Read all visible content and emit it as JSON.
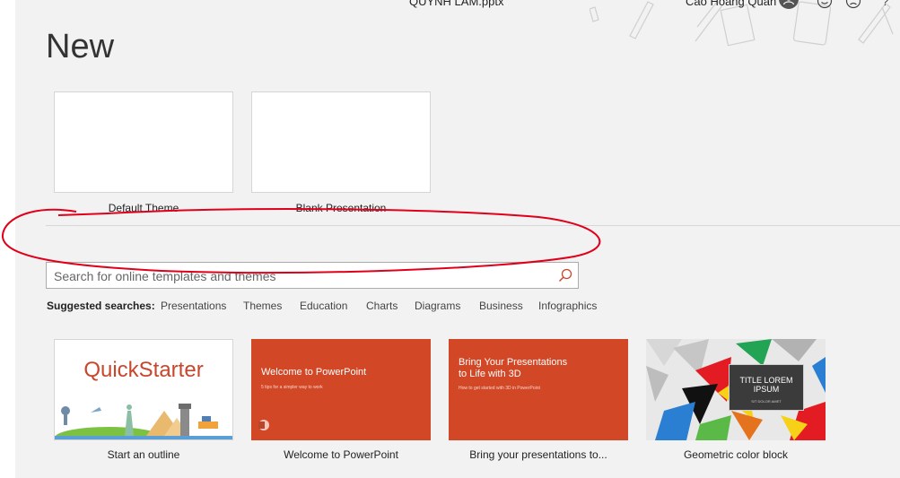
{
  "window": {
    "file_name": "QUYNH LAM.pptx",
    "user_name": "Cao Hoang Quan",
    "help_label": "?"
  },
  "page": {
    "heading": "New"
  },
  "blank_options": [
    {
      "caption": "Default Theme"
    },
    {
      "caption": "Blank Presentation"
    }
  ],
  "search": {
    "placeholder": "Search for online templates and themes",
    "value": ""
  },
  "suggested": {
    "label": "Suggested searches:",
    "items": [
      "Presentations",
      "Themes",
      "Education",
      "Charts",
      "Diagrams",
      "Business",
      "Infographics"
    ]
  },
  "templates": [
    {
      "caption": "Start an outline",
      "title": "QuickStarter"
    },
    {
      "caption": "Welcome to PowerPoint",
      "title": "Welcome to PowerPoint",
      "subtitle": "5 tips for a simpler way to work"
    },
    {
      "caption": "Bring your presentations to...",
      "title_line1": "Bring Your Presentations",
      "title_line2": "to Life with 3D",
      "subtitle": "How to get started with 3D in PowerPoint"
    },
    {
      "caption": "Geometric color block",
      "title_line1": "TITLE LOREM",
      "title_line2": "IPSUM",
      "subtitle": "SIT DOLOR AMET"
    }
  ],
  "colors": {
    "background": "#f2f2f2",
    "powerpoint_orange": "#d24726",
    "annotation_red": "#e0001a"
  }
}
